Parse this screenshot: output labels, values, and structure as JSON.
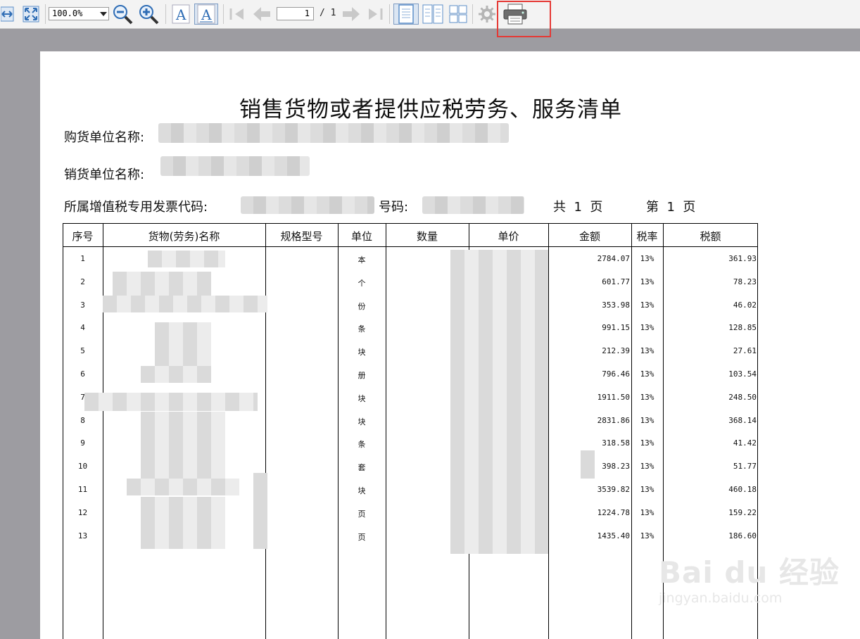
{
  "toolbar": {
    "zoom_value": "100.0%",
    "page_current": "1",
    "page_total": "/ 1",
    "font_icon_label": "A"
  },
  "doc": {
    "title": "销售货物或者提供应税劳务、服务清单",
    "buyer_label": "购货单位名称:",
    "seller_label": "销货单位名称:",
    "invoice_code_label": "所属增值税专用发票代码:",
    "number_label": "号码:",
    "pages_text": "共  1  页",
    "page_no_text": "第  1  页"
  },
  "table": {
    "headers": [
      "序号",
      "货物(劳务)名称",
      "规格型号",
      "单位",
      "数量",
      "单价",
      "金额",
      "税率",
      "税额"
    ],
    "rows": [
      {
        "no": "1",
        "unit": "本",
        "amount": "2784.07",
        "rate": "13%",
        "tax": "361.93"
      },
      {
        "no": "2",
        "unit": "个",
        "amount": "601.77",
        "rate": "13%",
        "tax": "78.23"
      },
      {
        "no": "3",
        "unit": "份",
        "amount": "353.98",
        "rate": "13%",
        "tax": "46.02"
      },
      {
        "no": "4",
        "unit": "条",
        "amount": "991.15",
        "rate": "13%",
        "tax": "128.85"
      },
      {
        "no": "5",
        "unit": "块",
        "amount": "212.39",
        "rate": "13%",
        "tax": "27.61"
      },
      {
        "no": "6",
        "unit": "册",
        "amount": "796.46",
        "rate": "13%",
        "tax": "103.54"
      },
      {
        "no": "7",
        "unit": "块",
        "amount": "1911.50",
        "rate": "13%",
        "tax": "248.50"
      },
      {
        "no": "8",
        "unit": "块",
        "amount": "2831.86",
        "rate": "13%",
        "tax": "368.14"
      },
      {
        "no": "9",
        "unit": "条",
        "amount": "318.58",
        "rate": "13%",
        "tax": "41.42"
      },
      {
        "no": "10",
        "unit": "套",
        "amount": "398.23",
        "rate": "13%",
        "tax": "51.77"
      },
      {
        "no": "11",
        "unit": "块",
        "amount": "3539.82",
        "rate": "13%",
        "tax": "460.18"
      },
      {
        "no": "12",
        "unit": "页",
        "amount": "1224.78",
        "rate": "13%",
        "tax": "159.22"
      },
      {
        "no": "13",
        "unit": "页",
        "amount": "1435.40",
        "rate": "13%",
        "tax": "186.60"
      }
    ]
  },
  "watermark": {
    "main": "Bai du 经验",
    "sub": "jingyan.baidu.com"
  },
  "colors": {
    "highlight": "#e53935",
    "viewer_background": "#9d9ca1",
    "toolbar": "#f3f3f3"
  }
}
